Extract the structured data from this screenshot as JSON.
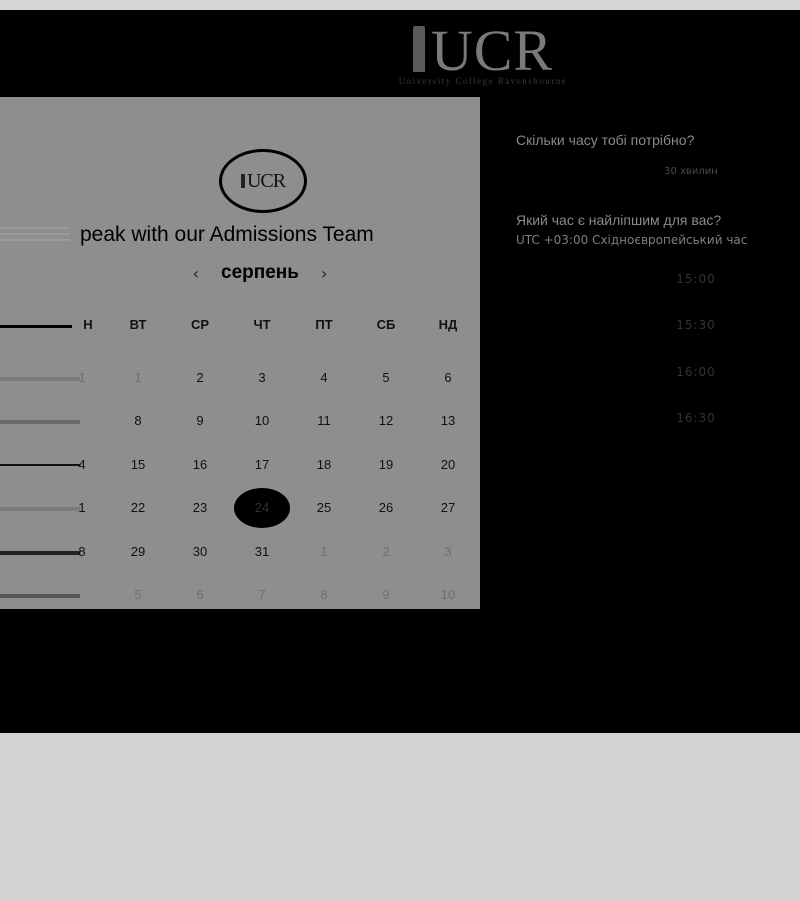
{
  "header": {
    "logo_text": "UCR",
    "logo_tagline": "University College Ravensbourne"
  },
  "calendar": {
    "card_logo_text": "UCR",
    "title": "peak with our Admissions Team",
    "month": "серпень",
    "prev_icon": "‹",
    "next_icon": "›",
    "weekdays": [
      "Н",
      "ВТ",
      "СР",
      "ЧТ",
      "ПТ",
      "СБ",
      "НД"
    ],
    "weeks": [
      [
        "1",
        "1",
        "2",
        "3",
        "4",
        "5",
        "6"
      ],
      [
        "",
        "8",
        "9",
        "10",
        "11",
        "12",
        "13"
      ],
      [
        "4",
        "15",
        "16",
        "17",
        "18",
        "19",
        "20"
      ],
      [
        "1",
        "22",
        "23",
        "24",
        "25",
        "26",
        "27"
      ],
      [
        "8",
        "29",
        "30",
        "31",
        "1",
        "2",
        "3"
      ],
      [
        "",
        "5",
        "6",
        "7",
        "8",
        "9",
        "10"
      ]
    ],
    "selected_day": "24"
  },
  "booking": {
    "duration_question": "Скільки часу тобі потрібно?",
    "duration_value": "30 хвилин",
    "time_question": "Який час є найліпшим для вас?",
    "timezone": "UTC +03:00 Східноєвропейський час",
    "slots": [
      "15:00",
      "15:30",
      "16:00",
      "16:30"
    ]
  },
  "colors": {
    "page_bg": "#d3d3d3",
    "modal_bg": "#000000",
    "card_bg": "#8e8e8e",
    "selected_day_bg": "#000000"
  }
}
